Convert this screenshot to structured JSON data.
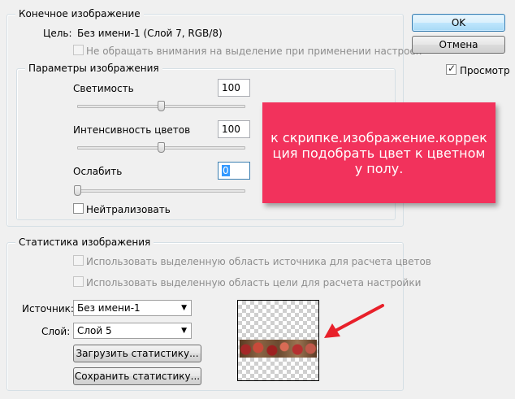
{
  "dialog": {
    "ok_label": "OK",
    "cancel_label": "Отмена",
    "preview_label": "Просмотр",
    "preview_checked": true
  },
  "target_image": {
    "title": "Конечное изображение",
    "target_label": "Цель:",
    "target_value": "Без имени-1 (Слой 7, RGB/8)",
    "ignore_selection_label": "Не обращать внимания на выделение при применении настроек"
  },
  "image_options": {
    "title": "Параметры изображения",
    "luminance_label": "Светимость",
    "luminance_value": "100",
    "luminance_level": 100,
    "color_intensity_label": "Интенсивность цветов",
    "color_intensity_value": "100",
    "color_intensity_level": 100,
    "fade_label": "Ослабить",
    "fade_value": "0",
    "fade_level": 0,
    "neutralize_label": "Нейтрализовать"
  },
  "statistics": {
    "title": "Статистика изображения",
    "use_source_selection_label": "Использовать выделенную область источника для расчета цветов",
    "use_target_selection_label": "Использовать выделенную область цели для расчета настройки",
    "source_label": "Источник:",
    "source_value": "Без имени-1",
    "layer_label": "Слой:",
    "layer_value": "Слой 5",
    "load_stats_label": "Загрузить статистику...",
    "save_stats_label": "Сохранить статистику..."
  },
  "annotation": {
    "text": "к скрипке.изображение.коррекция подобрать цвет к цветному полу.",
    "color": "#f2325c",
    "arrow_color": "#e8202a"
  }
}
